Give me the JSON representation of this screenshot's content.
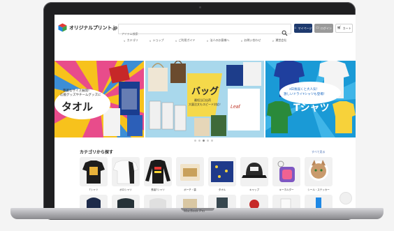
{
  "device": {
    "model_label": "MacBook Pro"
  },
  "header": {
    "logo_text": "オリジナルプリント.jp",
    "search_placeholder": "アイテム検索",
    "buttons": {
      "mypage": "マイページ",
      "login": "ログイン",
      "cart": "カート"
    }
  },
  "nav": {
    "items": [
      "カテゴリ",
      "ショップ",
      "ご利用ガイド",
      "法人のお客様へ",
      "お問い合わせ",
      "運営会社"
    ]
  },
  "banners": {
    "left": {
      "caption_line1": "豊富なサイズ展開！",
      "caption_line2": "応援グッズやチームグッズに",
      "headline": "タオル"
    },
    "center": {
      "headline": "バッグ",
      "sub_line1": "最短当日出荷",
      "sub_line2": "大量注文もスピード対応！"
    },
    "right": {
      "caption_line1": "3日後届くと大人気！",
      "caption_line2": "激しいドライTシャツも登場！",
      "headline": "Tシャツ"
    },
    "dots_count": 5,
    "active_dot": 2
  },
  "categories": {
    "title": "カテゴリから探す",
    "more_link": "すべて見る",
    "items": [
      {
        "label": "Tシャツ",
        "icon": "tshirt-black-icon"
      },
      {
        "label": "ポロシャツ",
        "icon": "polo-white-icon"
      },
      {
        "label": "長袖Tシャツ",
        "icon": "longsleeve-icon"
      },
      {
        "label": "ポーチ・袋",
        "icon": "pouch-icon"
      },
      {
        "label": "タオル",
        "icon": "towel-icon"
      },
      {
        "label": "キャップ",
        "icon": "cap-icon"
      },
      {
        "label": "キーホルダー",
        "icon": "keyholder-icon"
      },
      {
        "label": "シール・ステッカー",
        "icon": "sticker-icon"
      }
    ]
  },
  "colors": {
    "mypage_button": "#1e3a6e",
    "login_button": "#9a9a9a",
    "link": "#4a6fb5"
  }
}
